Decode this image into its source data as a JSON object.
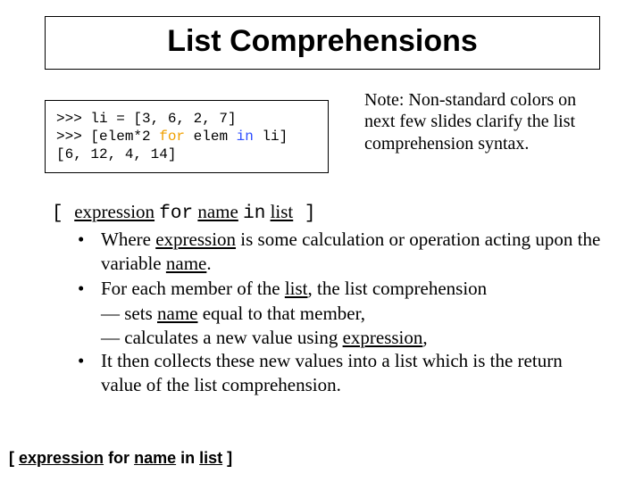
{
  "title": "List Comprehensions",
  "code": {
    "l1_prompt": ">>> ",
    "l1_rest": "li = [3, 6, 2, 7]",
    "l2_prompt": ">>> ",
    "l2_a": "[elem*2 ",
    "l2_for": "for",
    "l2_b": " elem ",
    "l2_in": "in",
    "l2_c": " li]",
    "l3": "[6, 12, 4, 14]"
  },
  "note": "Note: Non-standard colors on next few slides clarify the list comprehension syntax.",
  "syntax": {
    "open": "[ ",
    "expr": "expression",
    "sp1": " ",
    "for": "for",
    "sp2": " ",
    "name": "name",
    "sp3": " ",
    "in": "in",
    "sp4": " ",
    "list": "list",
    "close": " ]"
  },
  "b1_a": "Where ",
  "b1_expr": "expression",
  "b1_b": " is some calculation or operation acting upon the variable ",
  "b1_name": "name",
  "b1_c": ".",
  "b2_a": "For each member of the ",
  "b2_list": "list",
  "b2_b": ", the list comprehension",
  "b2s1_a": "—  sets ",
  "b2s1_name": "name",
  "b2s1_b": " equal to that member,",
  "b2s2_a": "— calculates a new value using ",
  "b2s2_expr": "expression",
  "b2s2_b": ",",
  "b3": "It then collects these new values into a list which is the return value of the list comprehension.",
  "bottom": {
    "open": "[ ",
    "expr": "expression",
    "sp1": " ",
    "for": "for",
    "sp2": " ",
    "name": "name",
    "sp3": " ",
    "in": "in",
    "sp4": " ",
    "list": "list",
    "close": " ]"
  }
}
